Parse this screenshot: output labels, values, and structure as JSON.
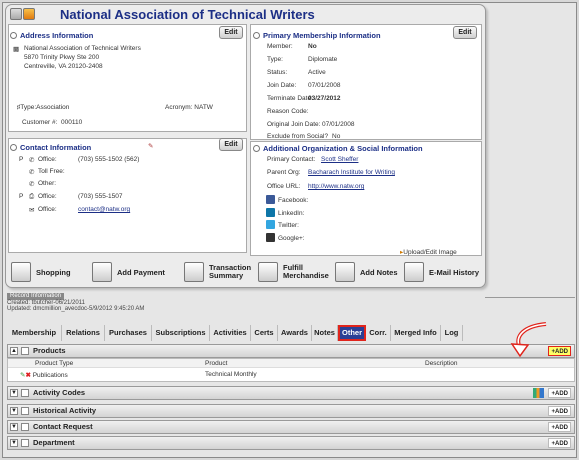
{
  "org_name": "National Association of Technical Writers",
  "address": {
    "header": "Address Information",
    "edit": "Edit",
    "lines": [
      "National Association of Technical Writers",
      "5870 Trinity Pkwy Ste 200",
      "Centreville, VA 20120-2408"
    ],
    "type_label": "Type:",
    "type_value": "Association",
    "acronym_label": "Acronym:",
    "acronym_value": "NATW",
    "customer_label": "Customer #:",
    "customer_value": "000110"
  },
  "membership": {
    "header": "Primary Membership Information",
    "edit": "Edit",
    "rows": [
      {
        "label": "Member:",
        "value": "No"
      },
      {
        "label": "Type:",
        "value": "Diplomate"
      },
      {
        "label": "Status:",
        "value": "Active"
      },
      {
        "label": "Join Date:",
        "value": "07/01/2008"
      },
      {
        "label": "Terminate Date:",
        "value": "03/27/2012"
      },
      {
        "label": "Reason Code:",
        "value": ""
      },
      {
        "label": "Original Join Date:",
        "value": "07/01/2008"
      },
      {
        "label": "Exclude from Social?",
        "value": "No"
      }
    ]
  },
  "contact": {
    "header": "Contact Information",
    "edit": "Edit",
    "rows": [
      {
        "flag": "P",
        "label": "Office:",
        "value": "(703) 555-1502 (562)"
      },
      {
        "flag": "",
        "label": "Toll Free:",
        "value": ""
      },
      {
        "flag": "",
        "label": "Other:",
        "value": ""
      },
      {
        "flag": "P",
        "label": "Office:",
        "value": "(703) 555-1507"
      },
      {
        "flag": "",
        "label": "Office:",
        "value": "contact@natw.org"
      }
    ]
  },
  "additional": {
    "header": "Additional Organization & Social Information",
    "primary_contact_label": "Primary Contact:",
    "primary_contact_value": "Scott Sheffer",
    "parent_org_label": "Parent Org:",
    "parent_org_value": "Bacharach Institute for Writing",
    "office_url_label": "Office URL:",
    "office_url_value": "http://www.natw.org",
    "social": [
      "Facebook:",
      "LinkedIn:",
      "Twitter:",
      "Google+:"
    ],
    "upload_image": "Upload/Edit Image"
  },
  "actions": [
    "Shopping",
    "Add Payment",
    "Transaction\nSummary",
    "Fulfill\nMerchandise",
    "Add Notes",
    "E-Mail History"
  ],
  "record_info": {
    "header": "Record Information",
    "created": "Created: tbutcher-06/21/2011",
    "updated": "Updated: dmcmillion_avecdoc-5/9/2012 9:45:20 AM"
  },
  "tabs": [
    "Membership",
    "Relations",
    "Purchases",
    "Subscriptions",
    "Activities",
    "Certs",
    "Awards",
    "Notes",
    "Other",
    "Corr.",
    "Merged Info",
    "Log"
  ],
  "active_tab": "Other",
  "add_label": "+ADD",
  "products": {
    "header": "Products",
    "columns": [
      "Product Type",
      "Product",
      "Description"
    ],
    "row": {
      "type": "Publications",
      "product": "Technical Monthly",
      "description": ""
    }
  },
  "groups": [
    "Activity Codes",
    "Historical Activity",
    "Contact Request",
    "Department"
  ],
  "colors": {
    "accent": "#1c2f86",
    "tab_active": "#2b3f95",
    "highlight": "#e0241c",
    "add_highlight": "#ffff66"
  }
}
